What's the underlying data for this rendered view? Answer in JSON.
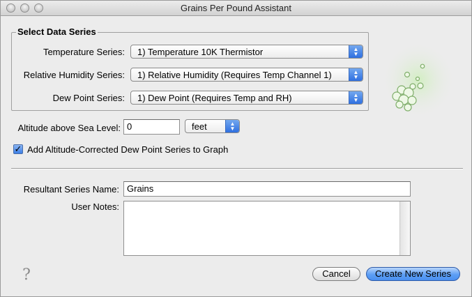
{
  "window": {
    "title": "Grains Per Pound Assistant"
  },
  "group": {
    "legend": "Select Data Series",
    "temperature": {
      "label": "Temperature Series:",
      "value": "1) Temperature 10K Thermistor"
    },
    "humidity": {
      "label": "Relative Humidity Series:",
      "value": "1) Relative Humidity (Requires Temp Channel 1)"
    },
    "dewpoint": {
      "label": "Dew Point Series:",
      "value": "1) Dew Point (Requires Temp and RH)"
    }
  },
  "altitude": {
    "label": "Altitude above Sea Level:",
    "value": "0",
    "unit": "feet"
  },
  "add_dewpoint": {
    "label": "Add Altitude-Corrected Dew Point Series to Graph",
    "checked": true
  },
  "resultant": {
    "label": "Resultant Series Name:",
    "value": "Grains"
  },
  "notes": {
    "label": "User Notes:",
    "value": ""
  },
  "buttons": {
    "help": "?",
    "cancel": "Cancel",
    "create": "Create New Series"
  },
  "colors": {
    "accent": "#4a90f0",
    "decoration": "#a8d890"
  }
}
